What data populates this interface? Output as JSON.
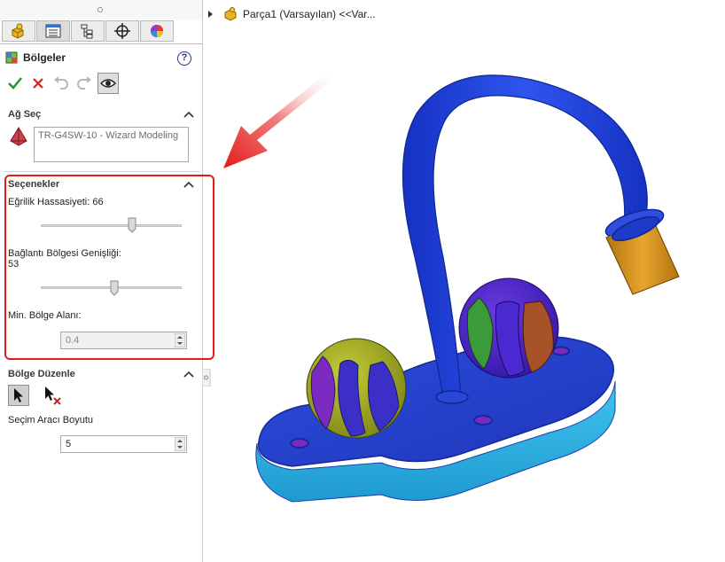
{
  "panel": {
    "tabs": [
      {
        "name": "part-icon",
        "active": false
      },
      {
        "name": "property-manager-icon",
        "active": true
      },
      {
        "name": "configuration-manager-icon",
        "active": false
      },
      {
        "name": "dimxpert-icon",
        "active": false
      },
      {
        "name": "display-manager-icon",
        "active": false
      }
    ],
    "title": "Bölgeler",
    "help_label": "?",
    "mesh_select": {
      "header": "Ağ Seç",
      "value": "TR-G4SW-10 - Wizard Modeling"
    },
    "options": {
      "header": "Seçenekler",
      "curvature_label": "Eğrilik Hassasiyeti: 66",
      "curvature_value": 66,
      "transition_label": "Bağlantı Bölgesi Genişliği:",
      "transition_value_text": "53",
      "transition_value": 53,
      "min_area_label": "Min. Bölge Alanı:",
      "min_area_value": "0.4"
    },
    "edit": {
      "header": "Bölge Düzenle",
      "tool_size_label": "Seçim Aracı Boyutu",
      "tool_size_value": "5"
    }
  },
  "tree": {
    "label": "Parça1 (Varsayılan) <<Var..."
  },
  "colors": {
    "highlight": "#e51a1a",
    "accept": "#1a9a2c",
    "cancel": "#d81e1e",
    "model_blue": "#1e3fd6",
    "model_cyan": "#2bb6e6",
    "sphere_yellow": "#a7b01e",
    "sphere_purple": "#5a2bc8",
    "spout_orange": "#d4901c"
  }
}
